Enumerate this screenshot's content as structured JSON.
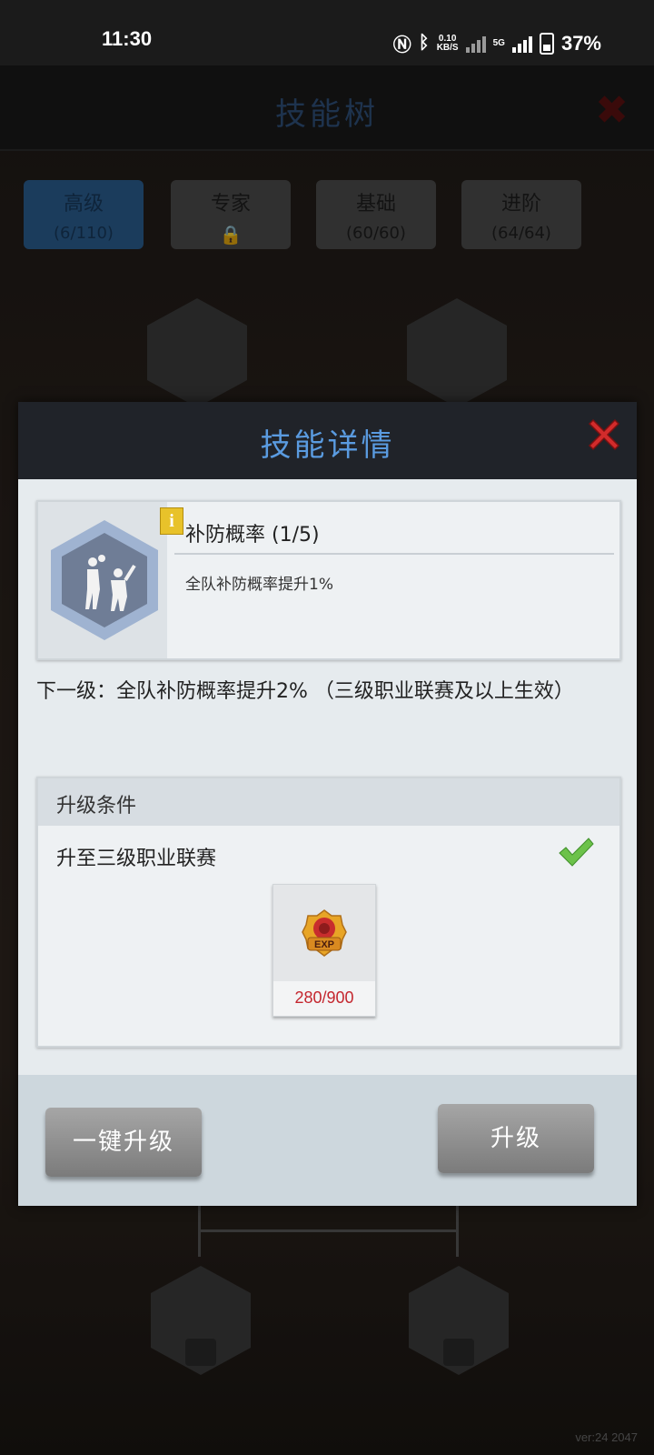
{
  "status_bar": {
    "time": "11:30",
    "net_speed_value": "0.10",
    "net_speed_unit": "KB/S",
    "network_type": "5G",
    "battery": "37%"
  },
  "background": {
    "title": "技能树",
    "tabs": [
      {
        "name": "高级",
        "sub": "(6/110)",
        "active": true
      },
      {
        "name": "专家",
        "sub": "",
        "locked": true
      },
      {
        "name": "基础",
        "sub": "(60/60)"
      },
      {
        "name": "进阶",
        "sub": "(64/64)"
      }
    ],
    "version": "ver:24  2047"
  },
  "dialog": {
    "title": "技能详情",
    "skill": {
      "name": "补防概率 (1/5)",
      "description": "全队补防概率提升1%",
      "info_badge": "i"
    },
    "next_level": "下一级：全队补防概率提升2% （三级职业联赛及以上生效）",
    "conditions": {
      "title": "升级条件",
      "items": [
        {
          "text": "升至三级职业联赛",
          "met": true
        }
      ],
      "cost": {
        "icon": "exp-icon",
        "icon_label": "EXP",
        "count": "280/900"
      }
    },
    "buttons": {
      "one_click": "一键升级",
      "upgrade": "升级"
    }
  },
  "colors": {
    "dialog_title": "#5a9be0",
    "cost_count": "#c4262e",
    "check": "#6cc24a",
    "close": "#d22b2b"
  }
}
